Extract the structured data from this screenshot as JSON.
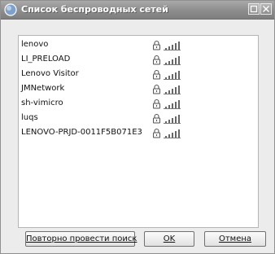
{
  "window": {
    "title": "Список беспроводных сетей",
    "icon": "app-globe-icon"
  },
  "titlebar_buttons": [
    "maximize-icon",
    "close-icon"
  ],
  "networks": [
    {
      "name": "lenovo",
      "locked": true,
      "signal_icon": "signal-strength-icon"
    },
    {
      "name": "LI_PRELOAD",
      "locked": true,
      "signal_icon": "signal-strength-icon"
    },
    {
      "name": "Lenovo Visitor",
      "locked": true,
      "signal_icon": "signal-strength-icon"
    },
    {
      "name": "JMNetwork",
      "locked": true,
      "signal_icon": "signal-strength-icon"
    },
    {
      "name": "sh-vimicro",
      "locked": true,
      "signal_icon": "signal-strength-icon"
    },
    {
      "name": "luqs",
      "locked": true,
      "signal_icon": "signal-strength-icon"
    },
    {
      "name": "LENOVO-PRJD-0011F5B071E3",
      "locked": true,
      "signal_icon": "signal-strength-icon"
    }
  ],
  "buttons": {
    "rescan": "Повторно провести поиск",
    "ok": "OK",
    "cancel": "Отмена"
  }
}
